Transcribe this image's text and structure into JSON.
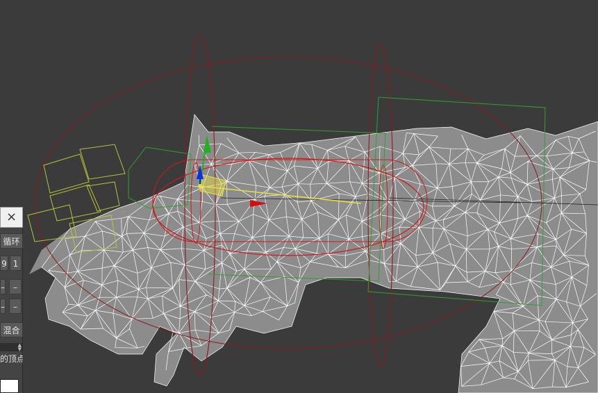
{
  "viewport": {
    "background_color": "#3b3b3b",
    "mesh_fill": "#8c8c8c",
    "wire_color": "#ffffff",
    "bone_dark_red": "#8b1a1a",
    "bone_red": "#d01818",
    "box_green": "#2fa02f",
    "box_yellow": "#b9c238",
    "gizmo_y_color": "#20b020",
    "gizmo_z_color": "#1030e0",
    "gizmo_x_color": "#d01010",
    "gizmo_plane_color": "#e8e040"
  },
  "panel": {
    "close_icon": "×",
    "loop_label": "循环",
    "spinner_a": "9",
    "spinner_b": "1",
    "minus_a1": "–",
    "minus_a2": "–",
    "minus_b1": "–",
    "minus_b2": "–",
    "blend_label": "混合",
    "vertex_label": "的顶点"
  }
}
